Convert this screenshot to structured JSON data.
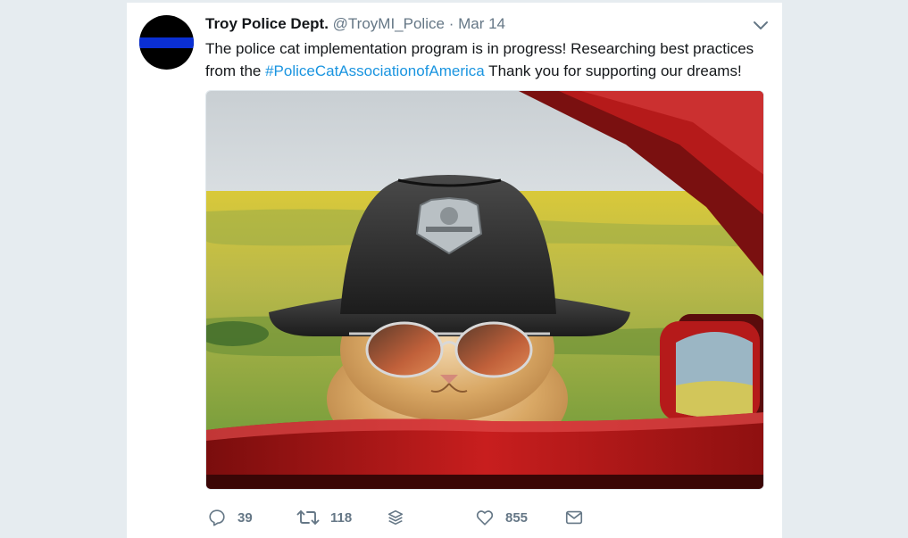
{
  "tweet": {
    "author_name": "Troy Police Dept.",
    "author_handle": "@TroyMI_Police",
    "separator": "·",
    "date": "Mar 14",
    "text_part1": "The police cat implementation program is in progress!  Researching best practices from the ",
    "hashtag": "#PoliceCatAssociationofAmerica",
    "text_part2": "  Thank you for supporting our dreams!",
    "image_subject": "cat wearing police hat and aviator sunglasses looking through car window"
  },
  "actions": {
    "reply": {
      "icon": "reply-icon",
      "count": "39"
    },
    "retweet": {
      "icon": "retweet-icon",
      "count": "118"
    },
    "stack": {
      "icon": "layers-icon"
    },
    "like": {
      "icon": "heart-icon",
      "count": "855"
    },
    "dm": {
      "icon": "envelope-icon"
    }
  },
  "colors": {
    "background": "#e6ecf0",
    "card": "#ffffff",
    "link": "#1b95e0",
    "muted": "#657786",
    "text": "#14171a",
    "avatar_stripe": "#0a2fd4"
  }
}
